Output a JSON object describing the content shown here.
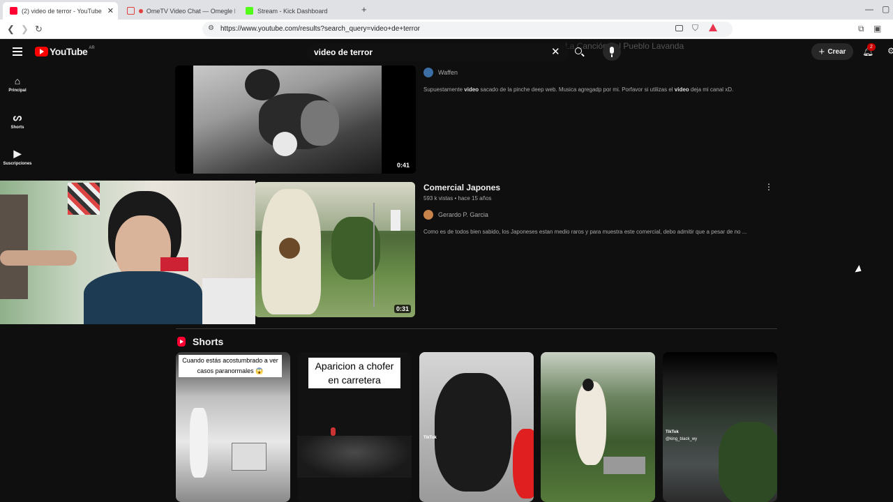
{
  "browser": {
    "tabs": [
      {
        "title": "(2) video de terror - YouTube",
        "color": "#ff0033",
        "close": "✕"
      },
      {
        "title": "OmeTV Video Chat — Omegle R",
        "color": "#e04040"
      },
      {
        "title": "Stream - Kick Dashboard",
        "color": "#53fc18"
      }
    ],
    "new_tab": "+",
    "url": "https://www.youtube.com/results?search_query=video+de+terror"
  },
  "youtube": {
    "logo_text": "YouTube",
    "country": "AR",
    "search_query": "video de terror",
    "create_label": "Crear",
    "notif_count": "2",
    "sidebar": [
      {
        "label": "Principal",
        "icon": "home-icon"
      },
      {
        "label": "Shorts",
        "icon": "shorts-icon"
      },
      {
        "label": "Suscripciones",
        "icon": "subscriptions-icon"
      }
    ],
    "overlay_text": "La Canción del Pueblo Lavanda",
    "results": [
      {
        "duration": "0:41",
        "channel": "Waffen",
        "description_parts": [
          "Supuestamente ",
          "video",
          " sacado de la pinche deep web. Musica agregadp por mi. Porfavor si utilizas el ",
          "video",
          " deja mi canal xD."
        ]
      },
      {
        "title": "Comercial Japones",
        "meta": "593 k vistas • hace 15 años",
        "duration": "0:31",
        "channel": "Gerardo P. Garcia",
        "description": "Como es de todos bien sabido, los Japoneses estan medio raros y para muestra este comercial, debo admitir que a pesar de no ..."
      }
    ],
    "shorts_heading": "Shorts",
    "shorts": [
      {
        "caption": "Cuando estás acostumbrado a ver casos paranormales 😱"
      },
      {
        "caption": "Aparicion a chofer en carretera"
      },
      {
        "caption": "",
        "tiktok": "TikTok"
      },
      {
        "caption": ""
      },
      {
        "caption": "",
        "tiktok": "TikTok",
        "handle": "@king_black_wy"
      }
    ]
  }
}
